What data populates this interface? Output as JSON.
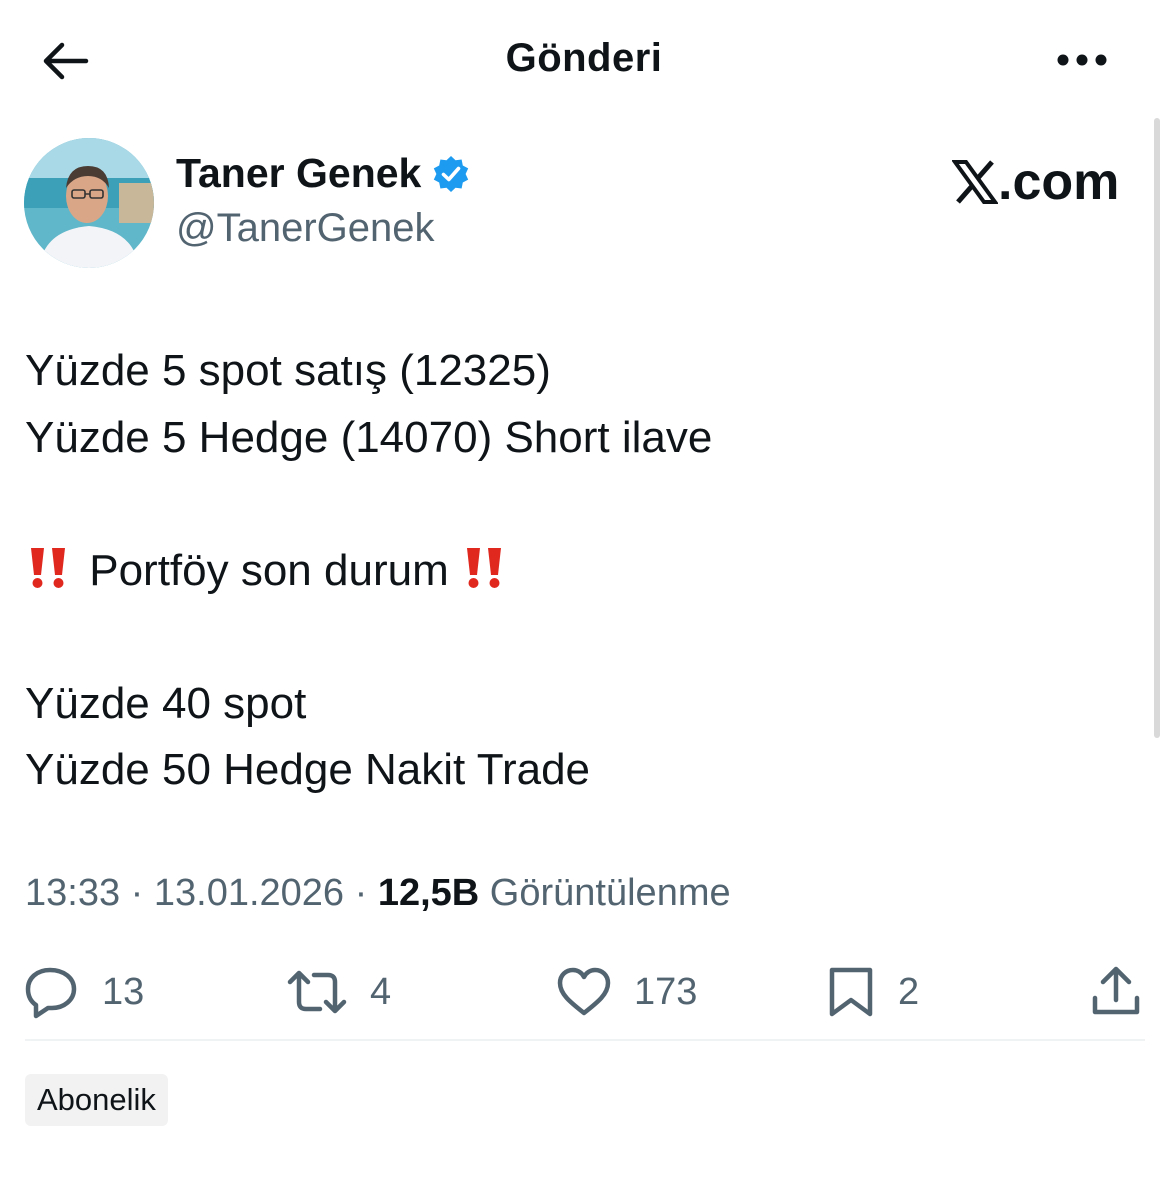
{
  "header": {
    "title": "Gönderi"
  },
  "author": {
    "name": "Taner Genek",
    "handle": "@TanerGenek",
    "verified": true,
    "site_badge": ".com"
  },
  "tweet": {
    "lines": [
      "Yüzde 5 spot satış (12325)",
      "Yüzde 5 Hedge (14070) Short ilave",
      "",
      " Portföy son durum ",
      "",
      "Yüzde 40 spot",
      "Yüzde 50 Hedge Nakit Trade"
    ]
  },
  "meta": {
    "time": "13:33",
    "sep1": " · ",
    "date": "13.01.2026",
    "sep2": " · ",
    "views_count": "12,5B",
    "views_label": " Görüntülenme"
  },
  "actions": {
    "replies": "13",
    "reposts": "4",
    "likes": "173",
    "bookmarks": "2"
  },
  "chip": {
    "label": "Abonelik"
  },
  "colors": {
    "text": "#0f1419",
    "secondary": "#536471",
    "verified": "#1d9bf0",
    "alert": "#e0281f"
  },
  "icons": [
    "back-arrow-icon",
    "more-icon",
    "verified-icon",
    "reply-icon",
    "repost-icon",
    "like-icon",
    "bookmark-icon",
    "share-icon",
    "double-exclamation-icon"
  ]
}
